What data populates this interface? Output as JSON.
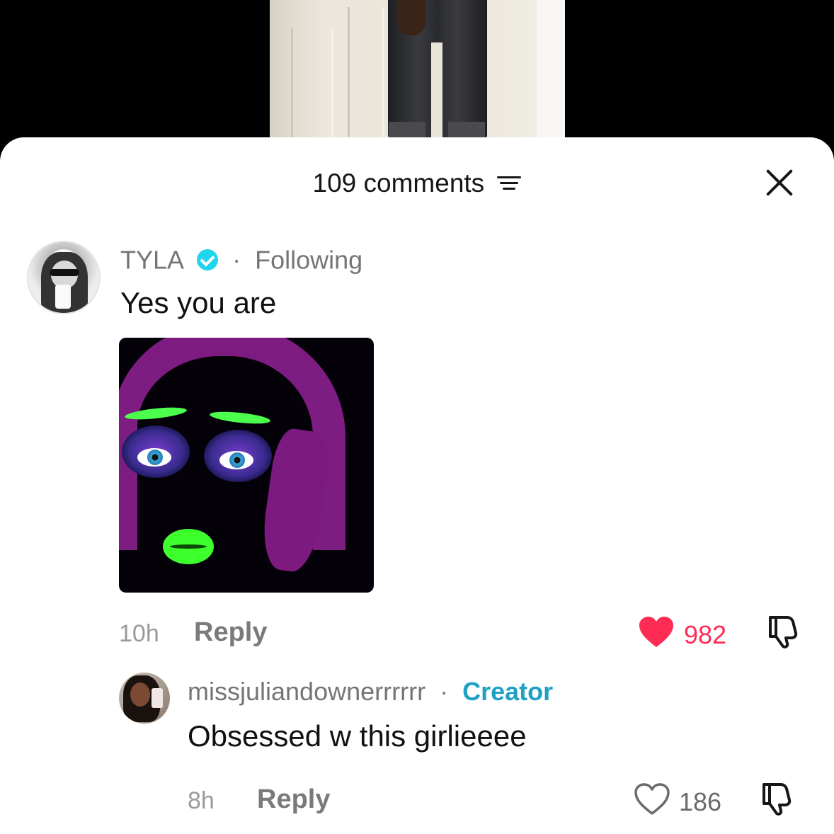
{
  "header": {
    "comment_count_label": "109 comments"
  },
  "comments": [
    {
      "username": "TYLA",
      "verified": true,
      "relation": "Following",
      "text": "Yes you are",
      "time": "10h",
      "reply_label": "Reply",
      "likes": "982",
      "liked": true,
      "has_sticker": true
    },
    {
      "username": "missjuliandownerrrrrr",
      "relation": "Creator",
      "text": "Obsessed w this girlieeee",
      "time": "8h",
      "reply_label": "Reply",
      "likes": "186",
      "liked": false
    }
  ],
  "separator": "·",
  "colors": {
    "like_active": "#fe2c55",
    "verified": "#20d5ec",
    "creator": "#1fa1c4",
    "meta_text": "#757575"
  },
  "icons": [
    "sort-icon",
    "close-icon",
    "verified-icon",
    "heart-filled-icon",
    "heart-outline-icon",
    "dislike-icon"
  ]
}
